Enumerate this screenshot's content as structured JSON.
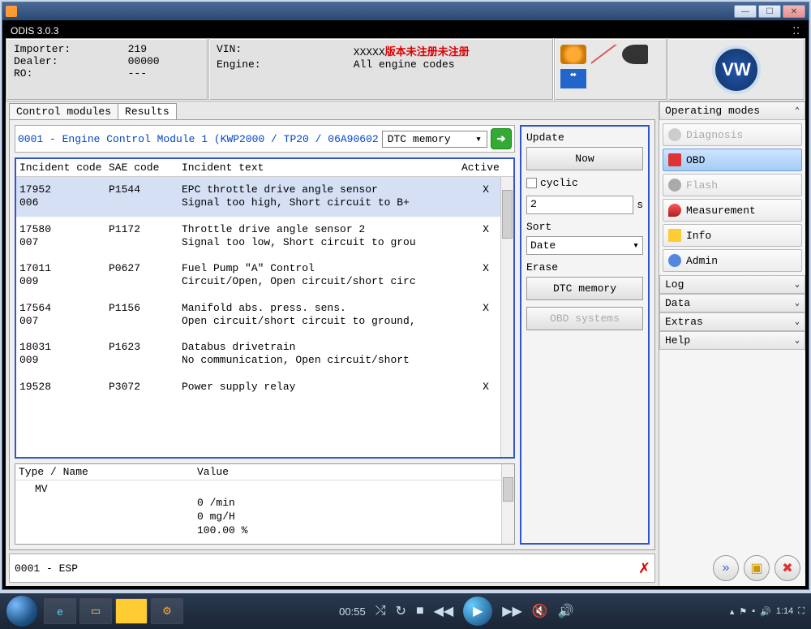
{
  "app": {
    "title": "ODIS 3.0.3"
  },
  "header": {
    "importer_label": "Importer:",
    "importer_value": "219",
    "dealer_label": "Dealer:",
    "dealer_value": "00000",
    "ro_label": "RO:",
    "ro_value": "---",
    "vin_label": "VIN:",
    "vin_value": "XXXXX",
    "vin_warning": "版本未注册未注册",
    "engine_label": "Engine:",
    "engine_value": "All engine codes",
    "usb_label": "⬌"
  },
  "tabs": {
    "control_modules": "Control modules",
    "results": "Results"
  },
  "module": {
    "label": "0001 - Engine Control Module 1  (KWP2000 / TP20 / 06A90602",
    "dropdown": "DTC memory"
  },
  "dtc": {
    "headers": {
      "incident_code": "Incident code",
      "sae_code": "SAE code",
      "incident_text": "Incident text",
      "active": "Active"
    },
    "rows": [
      {
        "code": "17952\n006",
        "sae": "P1544",
        "text": "EPC throttle drive angle sensor\nSignal too high, Short circuit to B+",
        "active": "X"
      },
      {
        "code": "17580\n007",
        "sae": "P1172",
        "text": "Throttle drive angle sensor 2\nSignal too low, Short circuit to grou",
        "active": "X"
      },
      {
        "code": "17011\n009",
        "sae": "P0627",
        "text": "Fuel Pump \"A\" Control\nCircuit/Open, Open circuit/short circ",
        "active": "X"
      },
      {
        "code": "17564\n007",
        "sae": "P1156",
        "text": "Manifold abs. press. sens.\nOpen circuit/short circuit to ground,",
        "active": "X"
      },
      {
        "code": "18031\n009",
        "sae": "P1623",
        "text": "Databus drivetrain\nNo communication, Open circuit/short",
        "active": ""
      },
      {
        "code": "19528",
        "sae": "P3072",
        "text": "Power supply relay",
        "active": "X"
      }
    ]
  },
  "values": {
    "header_type": "Type / Name",
    "header_value": "Value",
    "type": "MV",
    "rows": [
      "0 /min",
      "0 mg/H",
      "100.00 %"
    ]
  },
  "status": {
    "text": "0001 - ESP"
  },
  "controls": {
    "update": "Update",
    "now": "Now",
    "cyclic": "cyclic",
    "cyclic_value": "2",
    "cyclic_unit": "s",
    "sort": "Sort",
    "sort_value": "Date",
    "erase": "Erase",
    "dtc_memory": "DTC memory",
    "obd_systems": "OBD systems"
  },
  "sidebar": {
    "modes_header": "Operating modes",
    "diagnosis": "Diagnosis",
    "obd": "OBD",
    "flash": "Flash",
    "measurement": "Measurement",
    "info": "Info",
    "admin": "Admin",
    "sections": {
      "log": "Log",
      "data": "Data",
      "extras": "Extras",
      "help": "Help"
    }
  },
  "player": {
    "time": "00:55"
  },
  "tray": {
    "time": "1:14"
  }
}
